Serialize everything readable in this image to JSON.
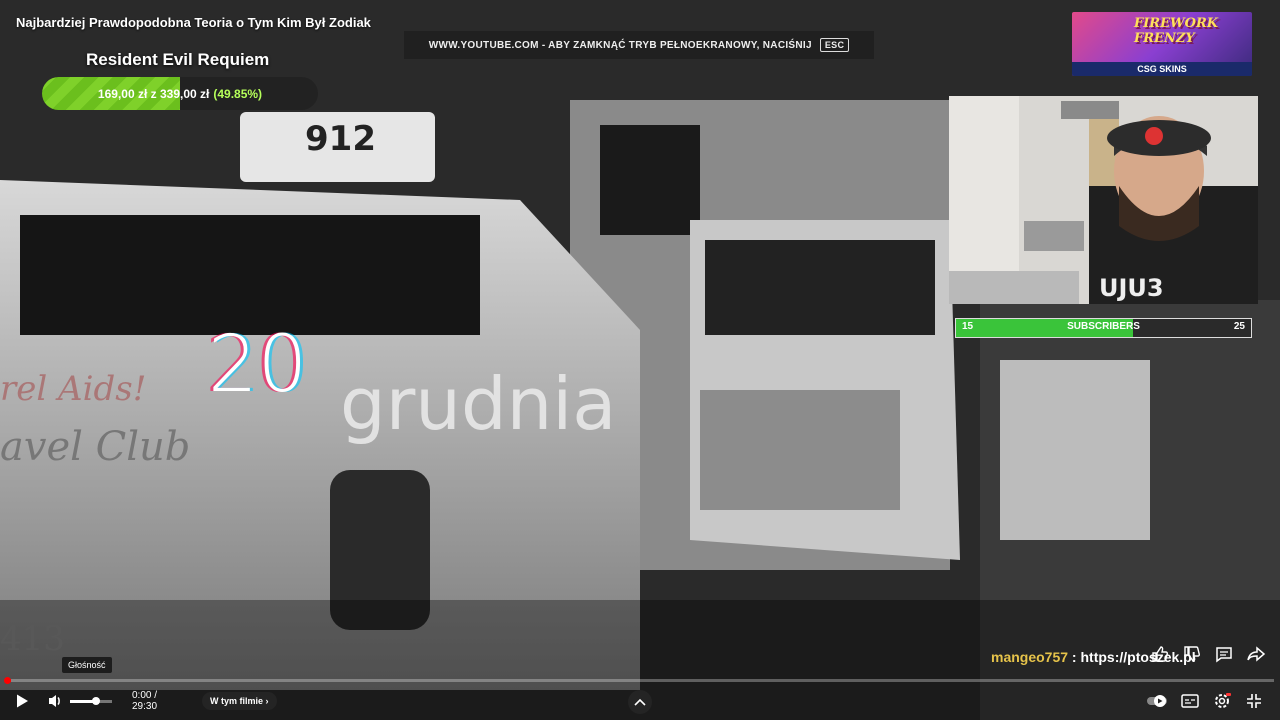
{
  "video": {
    "title": "Najbardziej Prawdopodobna Teoria o Tym Kim Był Zodiak",
    "overlay_day": "20",
    "overlay_month": "grudnia"
  },
  "fullscreen_notice": {
    "text": "WWW.YOUTUBE.COM - ABY ZAMKNĄĆ TRYB PEŁNOEKRANOWY, NACIŚNIJ",
    "key": "ESC"
  },
  "donation_goal": {
    "title": "Resident Evil Requiem",
    "current": "169,00 zł",
    "separator": "z",
    "target": "339,00 zł",
    "percent_label": "(49.85%)",
    "progress": 0.4985,
    "color": "#7fd12a"
  },
  "sponsor": {
    "title": "FIREWORK FRENZY",
    "brand": "CSG SKINS"
  },
  "subscribers_goal": {
    "current": "15",
    "label": "SUBSCRIBERS",
    "goal": "25",
    "progress": 0.6,
    "color": "#3ac43a"
  },
  "chat": {
    "user": "mangeo757",
    "separator": " : ",
    "message": "https://ptoszek.pl"
  },
  "tooltip": {
    "text": "Głośność"
  },
  "player": {
    "time": "0:00 / 29:30",
    "chapter_label": "W tym filmie",
    "progress": 0.0,
    "volume": 0.65,
    "accent": "#ff0000"
  },
  "icons": {
    "play": "play-icon",
    "volume": "volume-icon",
    "expand": "chevron-up-icon",
    "share": "share-icon",
    "comment": "comment-icon",
    "autoplay": "autoplay-toggle-icon",
    "subtitles": "subtitles-icon",
    "settings": "settings-icon",
    "exit_fullscreen": "exit-fullscreen-icon"
  }
}
